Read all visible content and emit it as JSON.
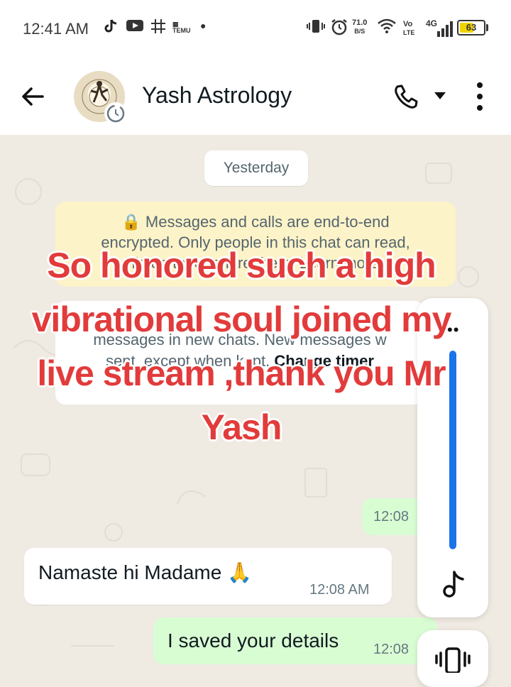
{
  "status_bar": {
    "time": "12:41 AM",
    "net_speed_value": "71.0",
    "net_speed_unit": "B/S",
    "volte_top": "Vo",
    "volte_bottom": "LTE",
    "network": "4G",
    "battery": "63",
    "battery_level_percent": 63,
    "icons": [
      "tiktok-icon",
      "youtube-icon",
      "grid-icon",
      "temu-icon",
      "dot-icon",
      "vibrate-icon",
      "alarm-icon",
      "wifi-icon",
      "signal-icon",
      "battery-icon"
    ]
  },
  "header": {
    "contact_name": "Yash Astrology",
    "icons": [
      "back-arrow-icon",
      "avatar",
      "call-icon",
      "dropdown-caret-icon",
      "more-vert-icon"
    ]
  },
  "chat": {
    "date_chip": "Yesterday",
    "encryption_notice_line1": "🔒 Messages and calls are end-to-end",
    "encryption_notice_line2": "encrypted. Only people in this chat can read,",
    "encryption_notice_line3": "listen to, or share them. Learn more",
    "timer_notice_line1": "messages in new chats. New messages w",
    "timer_notice_line2": "sent, except when kept.",
    "timer_notice_link": "Change timer",
    "messages": [
      {
        "direction": "outgoing",
        "text": "",
        "time": "12:08"
      },
      {
        "direction": "incoming",
        "text": "Namaste hi Madame 🙏",
        "time": "12:08 AM"
      },
      {
        "direction": "outgoing",
        "text": "I saved your details",
        "time": "12:08"
      }
    ]
  },
  "side_panel": {
    "dots": "••",
    "progress_percent": 100,
    "icons": [
      "music-note-icon",
      "vibrate-icon"
    ]
  },
  "overlay": {
    "line1": "So honored such a high",
    "line2": "vibrational soul joined my",
    "line3": "live stream ,thank you Mr",
    "line4": "Yash"
  },
  "colors": {
    "chat_background": "#efeae2",
    "outgoing_bubble": "#d9fdd3",
    "incoming_bubble": "#ffffff",
    "encryption_notice_bg": "#fdf3c8",
    "overlay_text": "#e23b3b",
    "progress": "#1a73e8",
    "battery": "#f1d300"
  }
}
